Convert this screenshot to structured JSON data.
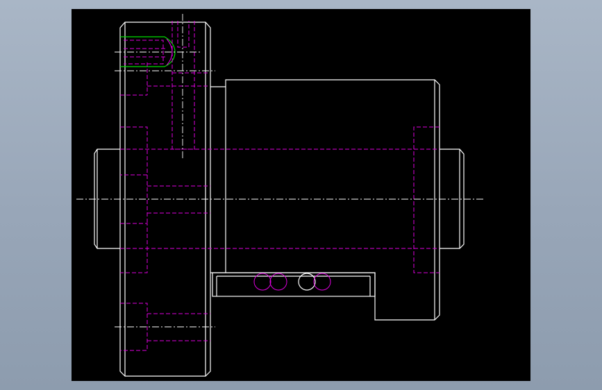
{
  "colors": {
    "background": "#000000",
    "frame": "#9aa8ba",
    "object_lines": "#ffffff",
    "hidden_lines": "#e000e0",
    "highlight": "#00e000"
  }
}
